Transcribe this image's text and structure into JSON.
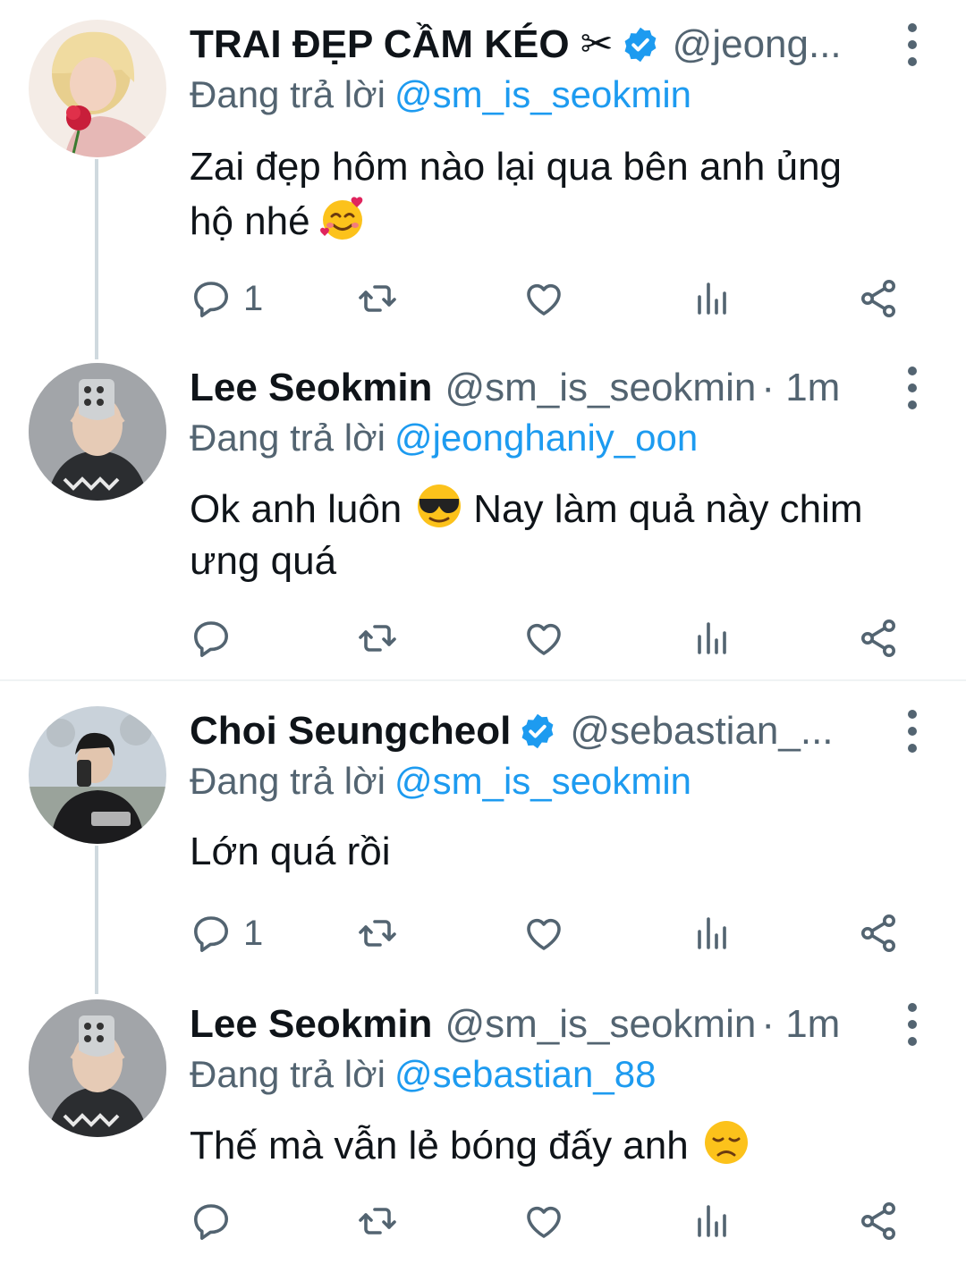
{
  "tweets": [
    {
      "name": "TRAI ĐẸP CẦM KÉO ✂",
      "verified": true,
      "handle": "@jeong...",
      "time": "",
      "reply_label": "Đang trả lời",
      "reply_to": "@sm_is_seokmin",
      "text_line1": "Zai đẹp hôm nào lại qua bên anh ủng",
      "text_line2": "hộ nhé",
      "emoji": "smiling-face-with-hearts",
      "reply_count": "1",
      "avatar_desc": "blonde-person-with-rose"
    },
    {
      "name": "Lee Seokmin",
      "verified": false,
      "handle": "@sm_is_seokmin",
      "time": "· 1m",
      "reply_label": "Đang trả lời",
      "reply_to": "@jeonghaniy_oon",
      "text_line1": "Ok anh luôn",
      "text_line1b": "Nay làm quả này chim",
      "text_line2": "ưng quá",
      "emoji": "sunglasses-face",
      "reply_count": "",
      "avatar_desc": "person-holding-phone"
    },
    {
      "name": "Choi Seungcheol",
      "verified": true,
      "handle": "@sebastian_...",
      "time": "",
      "reply_label": "Đang trả lời",
      "reply_to": "@sm_is_seokmin",
      "text_line1": "Lớn quá rồi",
      "reply_count": "1",
      "avatar_desc": "person-in-black-coat"
    },
    {
      "name": "Lee Seokmin",
      "verified": false,
      "handle": "@sm_is_seokmin",
      "time": "· 1m",
      "reply_label": "Đang trả lời",
      "reply_to": "@sebastian_88",
      "text_line1": "Thế mà vẫn lẻ bóng đấy anh",
      "emoji": "disappointed-face",
      "reply_count": "",
      "avatar_desc": "person-holding-phone"
    }
  ],
  "colors": {
    "link": "#1d9bf0",
    "secondary": "#536471",
    "text": "#0f1419",
    "thread_line": "#cfd9de"
  },
  "icons": [
    "reply-icon",
    "retweet-icon",
    "like-icon",
    "analytics-icon",
    "share-icon",
    "more-icon",
    "verified-icon"
  ]
}
